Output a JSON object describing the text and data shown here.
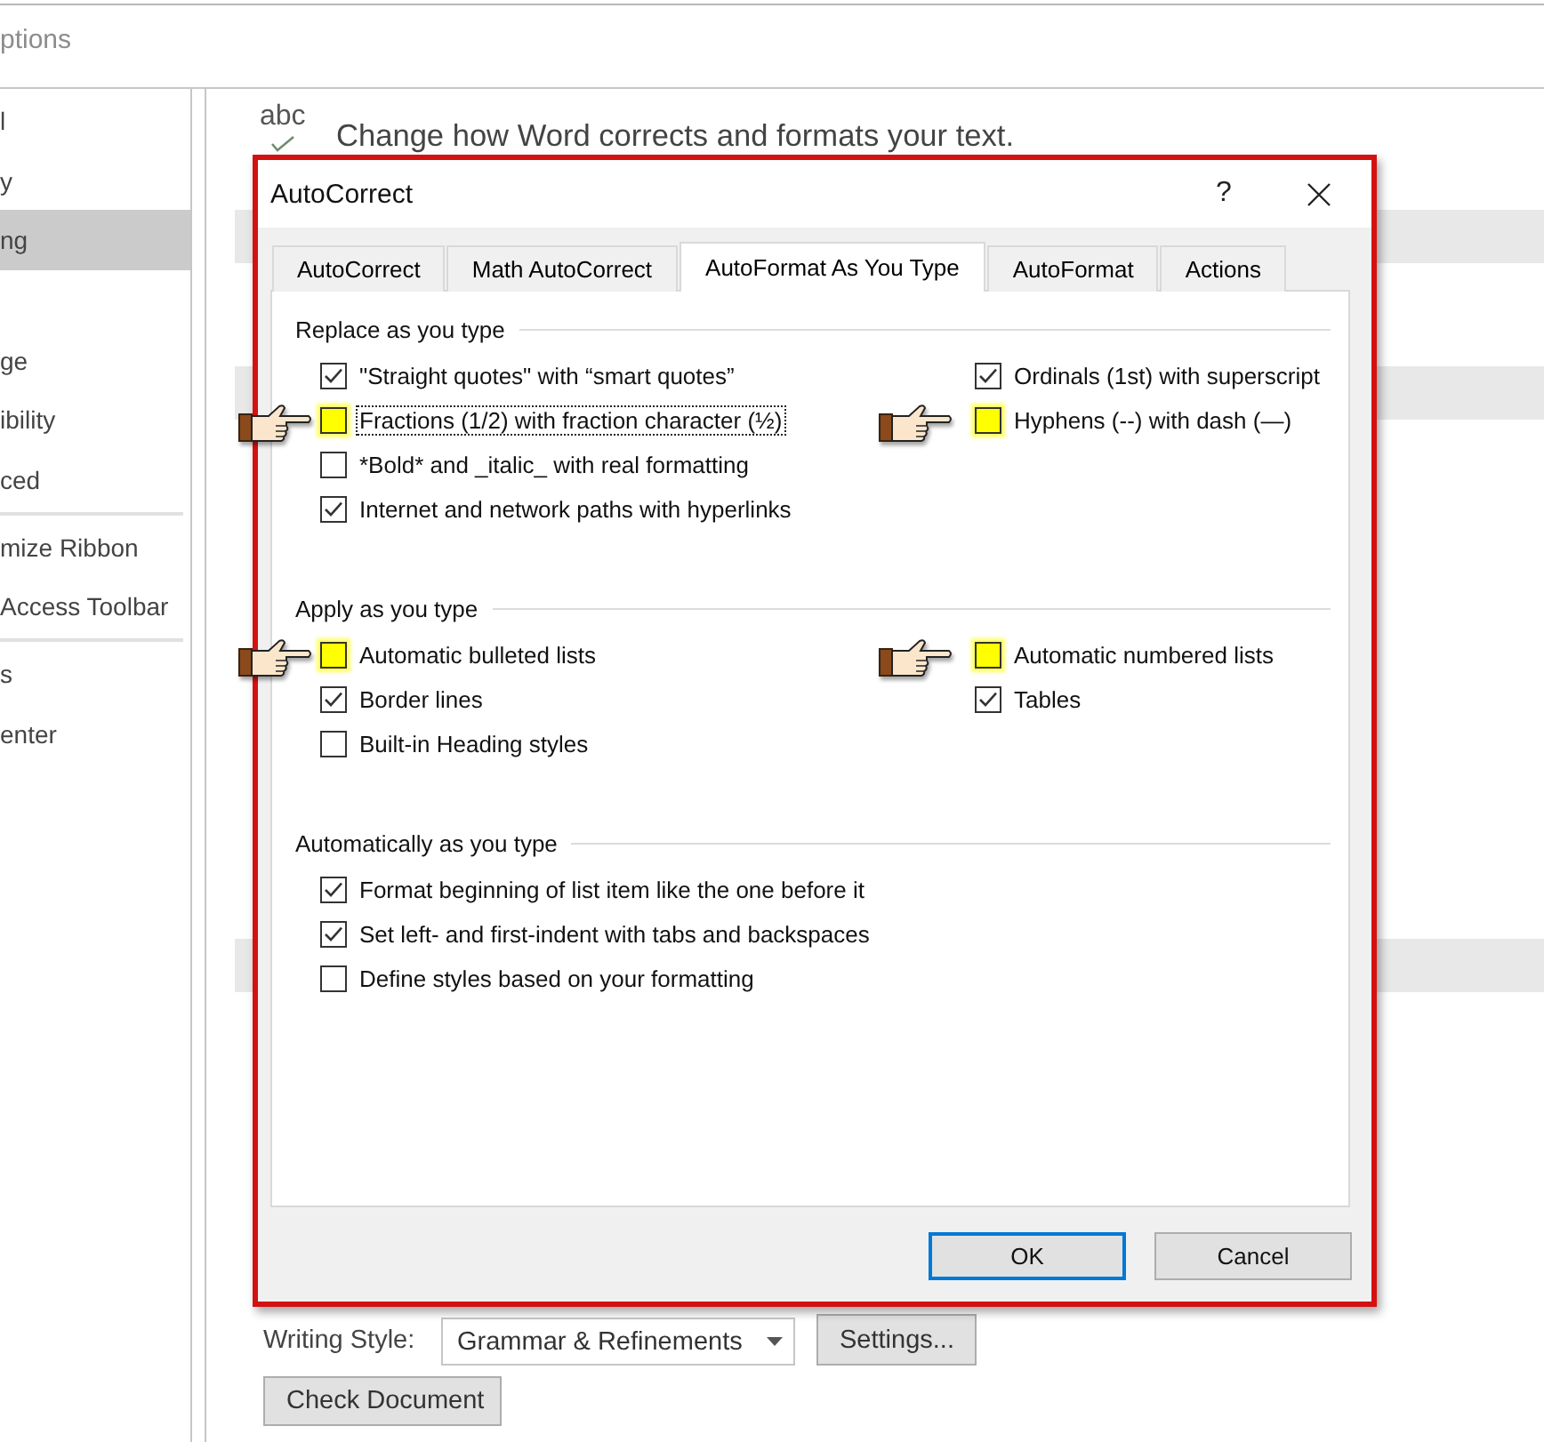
{
  "window": {
    "title": "ptions"
  },
  "sidebar": {
    "groups": [
      {
        "items": [
          {
            "label": "l",
            "selected": false
          },
          {
            "label": "y",
            "selected": false
          },
          {
            "label": "ng",
            "selected": true
          }
        ]
      },
      {
        "divider": false,
        "items": [
          {
            "label": "ge",
            "selected": false
          },
          {
            "label": "ibility",
            "selected": false
          },
          {
            "label": "ced",
            "selected": false
          }
        ]
      },
      {
        "divider": true,
        "items": [
          {
            "label": "mize Ribbon",
            "selected": false
          },
          {
            "label": "Access Toolbar",
            "selected": false
          }
        ]
      },
      {
        "divider": true,
        "items": [
          {
            "label": "s",
            "selected": false
          },
          {
            "label": "enter",
            "selected": false
          }
        ]
      }
    ]
  },
  "header": {
    "icon_text": "abc",
    "text": "Change how Word corrects and formats your text."
  },
  "dialog": {
    "title": "AutoCorrect",
    "help": "?",
    "tabs": [
      {
        "label": "AutoCorrect",
        "selected": false
      },
      {
        "label": "Math AutoCorrect",
        "selected": false
      },
      {
        "label": "AutoFormat As You Type",
        "selected": true
      },
      {
        "label": "AutoFormat",
        "selected": false
      },
      {
        "label": "Actions",
        "selected": false
      }
    ],
    "sections": [
      {
        "title": "Replace as you type",
        "columns": [
          {
            "items": [
              {
                "label": "\"Straight quotes\" with “smart quotes”",
                "checked": true,
                "highlighted": false,
                "focused": false
              },
              {
                "label": "Fractions (1/2) with fraction character (½)",
                "checked": false,
                "highlighted": true,
                "focused": true
              },
              {
                "label": "*Bold* and _italic_ with real formatting",
                "checked": false,
                "highlighted": false,
                "focused": false
              },
              {
                "label": "Internet and network paths with hyperlinks",
                "checked": true,
                "highlighted": false,
                "focused": false
              }
            ]
          },
          {
            "items": [
              {
                "label": "Ordinals (1st) with superscript",
                "checked": true,
                "highlighted": false,
                "focused": false
              },
              {
                "label": "Hyphens (--) with dash (—)",
                "checked": false,
                "highlighted": true,
                "focused": false
              }
            ]
          }
        ]
      },
      {
        "title": "Apply as you type",
        "columns": [
          {
            "items": [
              {
                "label": "Automatic bulleted lists",
                "checked": false,
                "highlighted": true,
                "focused": false
              },
              {
                "label": "Border lines",
                "checked": true,
                "highlighted": false,
                "focused": false
              },
              {
                "label": "Built-in Heading styles",
                "checked": false,
                "highlighted": false,
                "focused": false
              }
            ]
          },
          {
            "items": [
              {
                "label": "Automatic numbered lists",
                "checked": false,
                "highlighted": true,
                "focused": false
              },
              {
                "label": "Tables",
                "checked": true,
                "highlighted": false,
                "focused": false
              }
            ]
          }
        ]
      },
      {
        "title": "Automatically as you type",
        "columns": [
          {
            "items": [
              {
                "label": "Format beginning of list item like the one before it",
                "checked": true,
                "highlighted": false,
                "focused": false
              },
              {
                "label": "Set left- and first-indent with tabs and backspaces",
                "checked": true,
                "highlighted": false,
                "focused": false
              },
              {
                "label": "Define styles based on your formatting",
                "checked": false,
                "highlighted": false,
                "focused": false
              }
            ]
          }
        ]
      }
    ],
    "buttons": [
      {
        "label": "OK",
        "default": true
      },
      {
        "label": "Cancel",
        "default": false
      }
    ]
  },
  "writing_style": {
    "label": "Writing Style:",
    "value": "Grammar & Refinements"
  },
  "settings_button": {
    "label": "Settings..."
  },
  "check_button": {
    "label": "Check Document"
  }
}
